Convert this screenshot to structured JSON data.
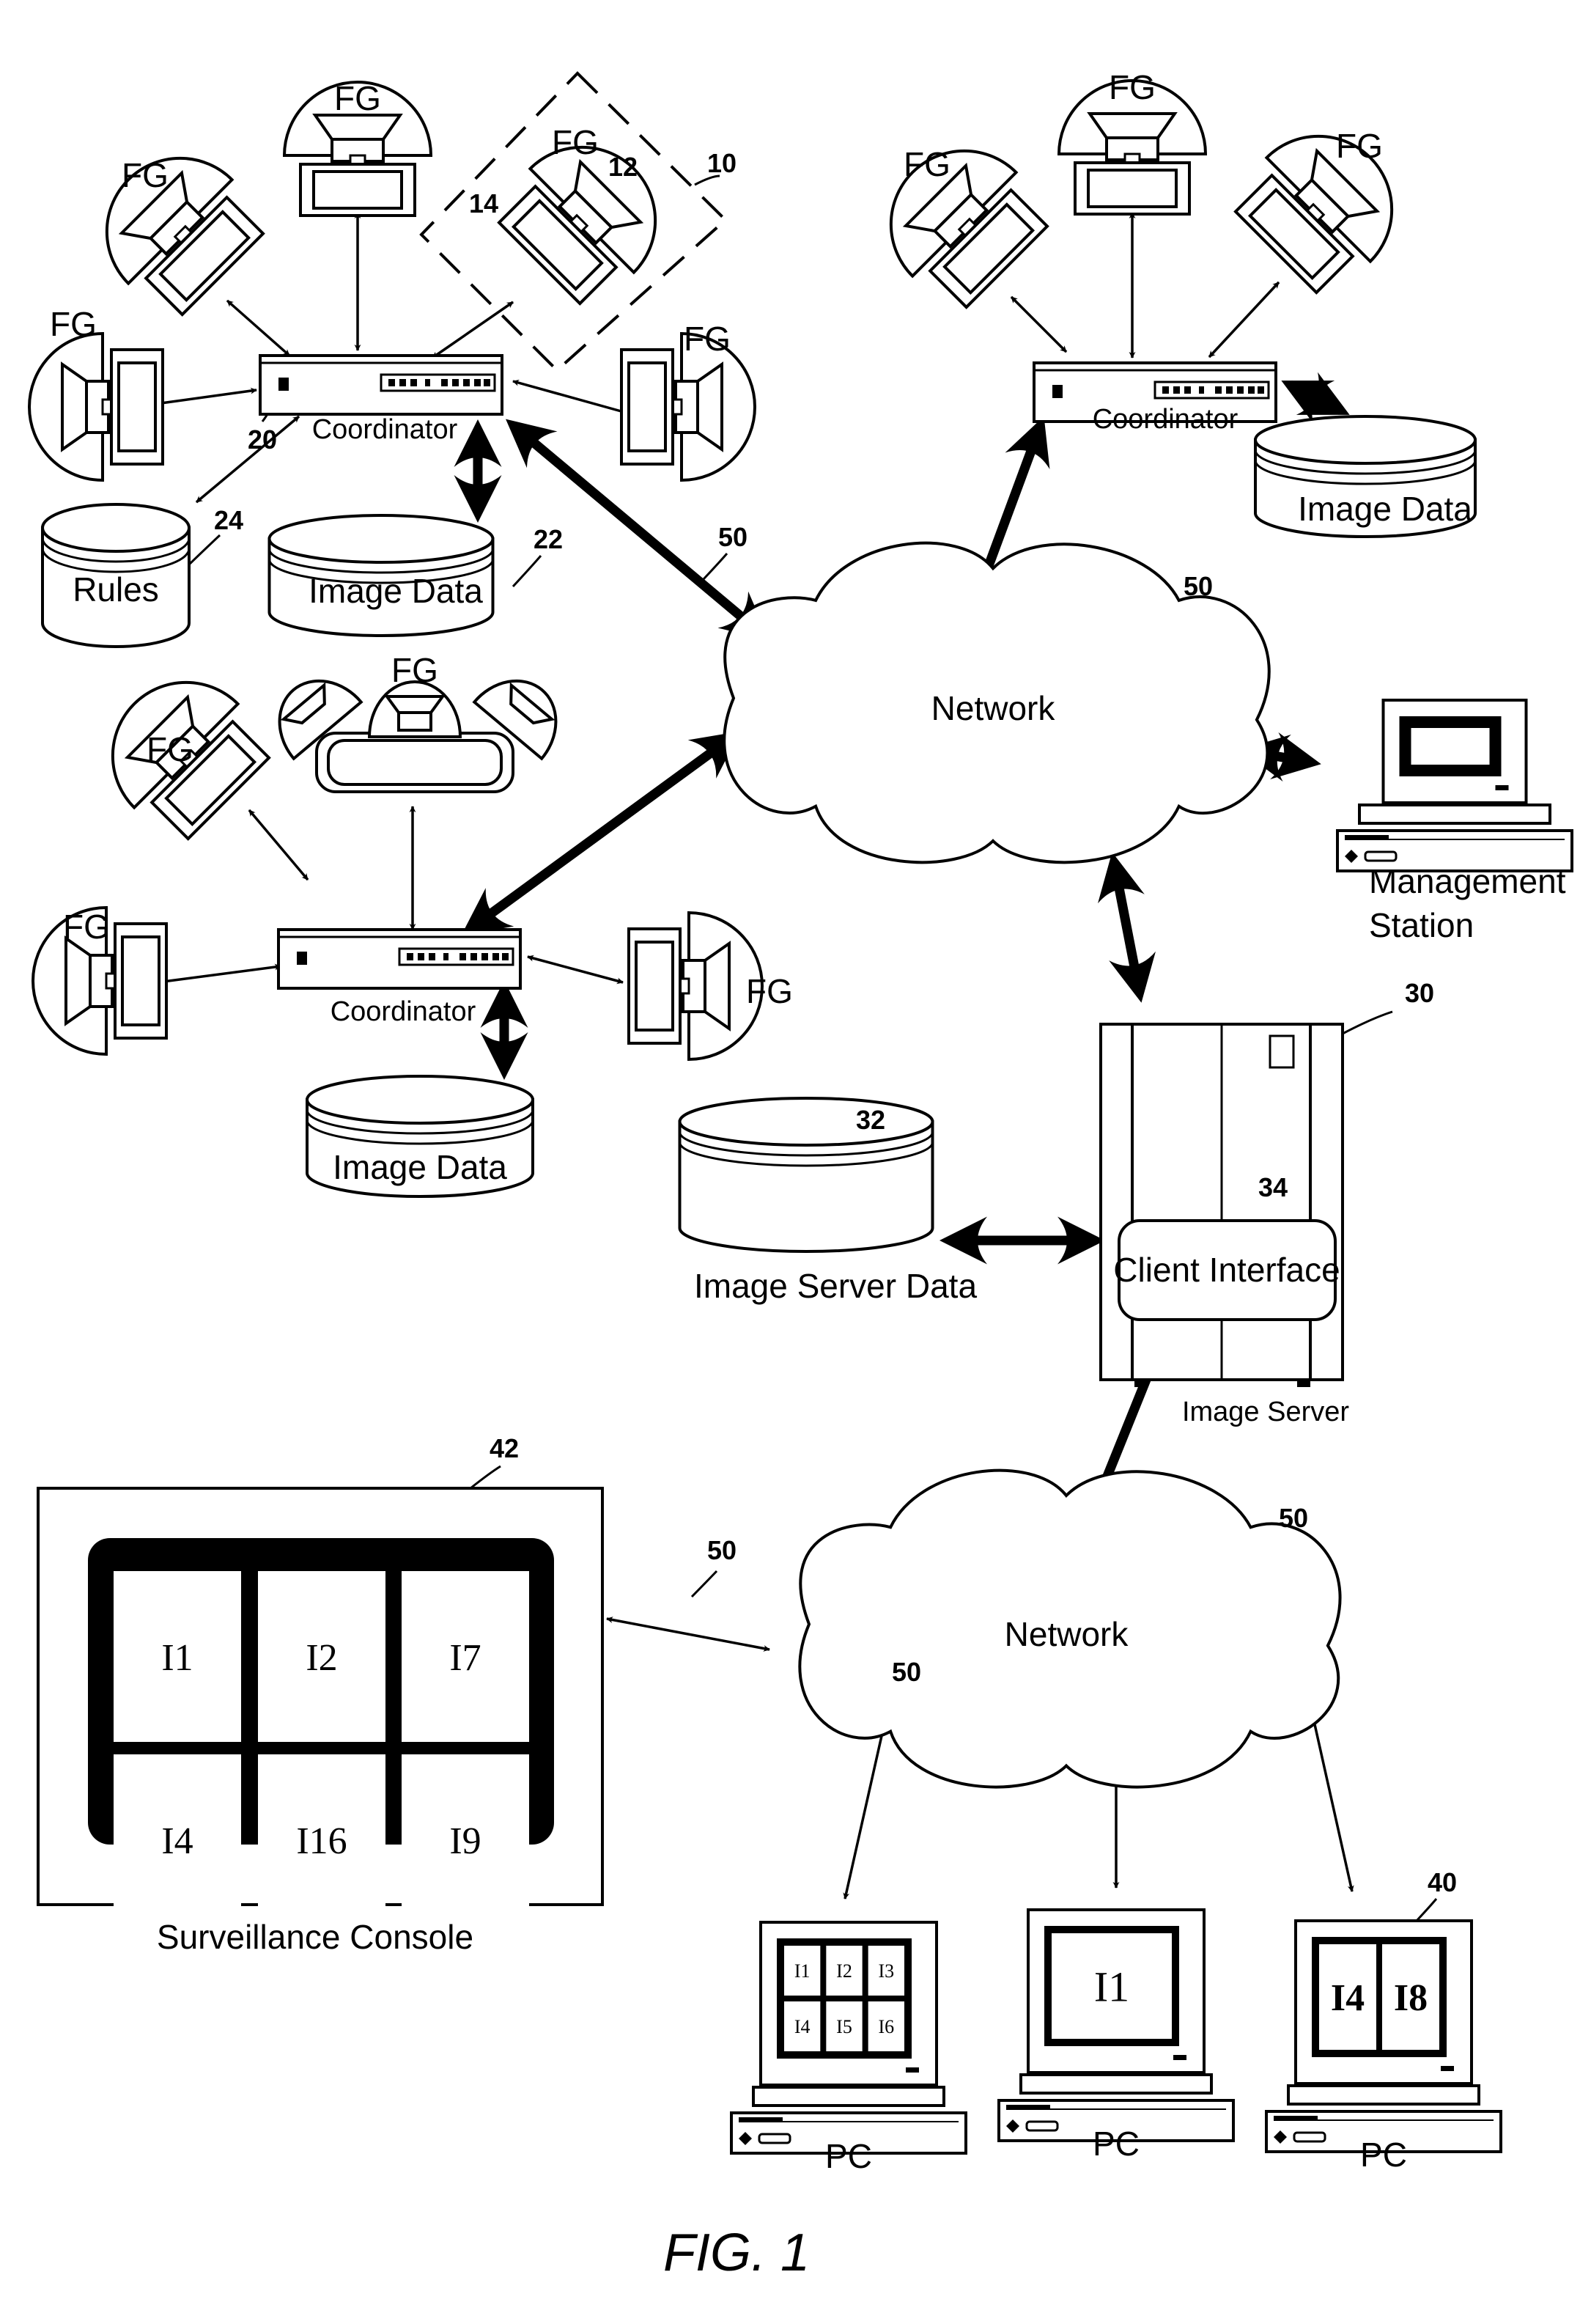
{
  "figure": {
    "caption": "FIG. 1",
    "ink_color": "#000000",
    "paper_color": "#ffffff"
  },
  "labels": {
    "fg": "FG",
    "coordinator": "Coordinator",
    "image_data": "Image Data",
    "rules": "Rules",
    "network": "Network",
    "management_station_line1": "Management",
    "management_station_line2": "Station",
    "image_server": "Image Server",
    "image_server_data": "Image Server Data",
    "client_interface": "Client Interface",
    "surveillance_console": "Surveillance Console",
    "pc": "PC"
  },
  "reference_numerals": {
    "frame_grabber_unit": "10",
    "camera": "12",
    "frame_grabber": "14",
    "coordinator": "20",
    "image_data": "22",
    "rules": "24",
    "image_server": "30",
    "image_server_data": "32",
    "client_interface": "34",
    "pc": "40",
    "surveillance_console": "42",
    "network": "50"
  },
  "surveillance_console": {
    "tiles": [
      "I1",
      "I2",
      "I7",
      "I4",
      "I16",
      "I9"
    ]
  },
  "pcs": [
    {
      "screen_tiles": [
        "I1",
        "I2",
        "I3",
        "I4",
        "I5",
        "I6"
      ],
      "label": "PC"
    },
    {
      "screen_tiles": [
        "I1"
      ],
      "label": "PC"
    },
    {
      "screen_tiles": [
        "I4",
        "I8"
      ],
      "label": "PC",
      "ref": "40"
    }
  ],
  "clusters": [
    {
      "id": "cluster-1",
      "fg_count": 5,
      "has_rules_db": true,
      "coordinator_ref": "20",
      "image_data_ref": "22",
      "rules_ref": "24"
    },
    {
      "id": "cluster-2",
      "fg_count": 3,
      "has_rules_db": false
    },
    {
      "id": "cluster-3",
      "fg_count": 5,
      "has_rules_db": false,
      "multi_camera_unit": true
    }
  ]
}
